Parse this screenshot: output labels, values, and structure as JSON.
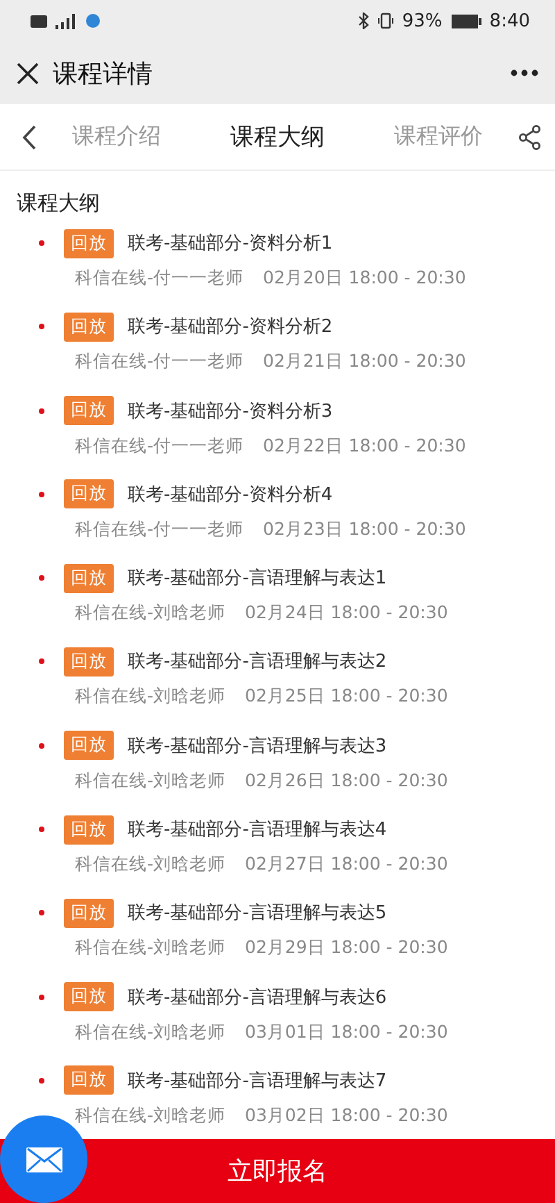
{
  "status_bar": {
    "battery_text": "93%",
    "time": "8:40"
  },
  "header": {
    "title": "课程详情"
  },
  "tabs": [
    {
      "label": "课程介绍",
      "selected": false
    },
    {
      "label": "课程大纲",
      "selected": true
    },
    {
      "label": "课程评价",
      "selected": false
    }
  ],
  "section_title": "课程大纲",
  "lessons": [
    {
      "tag": "回放",
      "title": "联考-基础部分-资料分析1",
      "teacher": "科信在线-付一一老师",
      "time": "02月20日 18:00 - 20:30"
    },
    {
      "tag": "回放",
      "title": "联考-基础部分-资料分析2",
      "teacher": "科信在线-付一一老师",
      "time": "02月21日 18:00 - 20:30"
    },
    {
      "tag": "回放",
      "title": "联考-基础部分-资料分析3",
      "teacher": "科信在线-付一一老师",
      "time": "02月22日 18:00 - 20:30"
    },
    {
      "tag": "回放",
      "title": "联考-基础部分-资料分析4",
      "teacher": "科信在线-付一一老师",
      "time": "02月23日 18:00 - 20:30"
    },
    {
      "tag": "回放",
      "title": "联考-基础部分-言语理解与表达1",
      "teacher": "科信在线-刘晗老师",
      "time": "02月24日 18:00 - 20:30"
    },
    {
      "tag": "回放",
      "title": "联考-基础部分-言语理解与表达2",
      "teacher": "科信在线-刘晗老师",
      "time": "02月25日 18:00 - 20:30"
    },
    {
      "tag": "回放",
      "title": "联考-基础部分-言语理解与表达3",
      "teacher": "科信在线-刘晗老师",
      "time": "02月26日 18:00 - 20:30"
    },
    {
      "tag": "回放",
      "title": "联考-基础部分-言语理解与表达4",
      "teacher": "科信在线-刘晗老师",
      "time": "02月27日 18:00 - 20:30"
    },
    {
      "tag": "回放",
      "title": "联考-基础部分-言语理解与表达5",
      "teacher": "科信在线-刘晗老师",
      "time": "02月29日 18:00 - 20:30"
    },
    {
      "tag": "回放",
      "title": "联考-基础部分-言语理解与表达6",
      "teacher": "科信在线-刘晗老师",
      "time": "03月01日 18:00 - 20:30"
    },
    {
      "tag": "回放",
      "title": "联考-基础部分-言语理解与表达7",
      "teacher": "科信在线-刘晗老师",
      "time": "03月02日 18:00 - 20:30"
    }
  ],
  "enroll_button": "立即报名"
}
